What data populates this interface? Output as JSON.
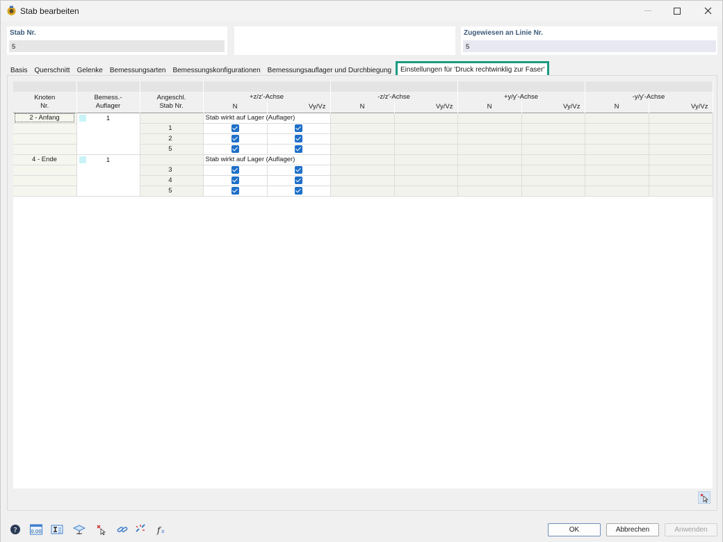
{
  "window": {
    "title": "Stab bearbeiten",
    "icon": "rstab-app-icon"
  },
  "header": {
    "stab_label": "Stab Nr.",
    "stab_value": "5",
    "zugewiesen_label": "Zugewiesen an Linie Nr.",
    "zugewiesen_value": "5"
  },
  "tabs": [
    {
      "label": "Basis"
    },
    {
      "label": "Querschnitt"
    },
    {
      "label": "Gelenke"
    },
    {
      "label": "Bemessungsarten"
    },
    {
      "label": "Bemessungskonfigurationen"
    },
    {
      "label": "Bemessungsauflager und Durchbiegung"
    },
    {
      "label": "Einstellungen für 'Druck rechtwinklig zur Faser'",
      "active": true
    }
  ],
  "table": {
    "col_knoten": "Knoten\nNr.",
    "col_knoten_l1": "Knoten",
    "col_knoten_l2": "Nr.",
    "col_bemess_l1": "Bemess.-",
    "col_bemess_l2": "Auflager",
    "col_angeschl_l1": "Angeschl.",
    "col_angeschl_l2": "Stab Nr.",
    "groups": [
      "+z/z'-Achse",
      "-z/z'-Achse",
      "+y/y'-Achse",
      "-y/y'-Achse"
    ],
    "sub_n": "N",
    "sub_v": "Vy/Vz",
    "rows": [
      {
        "knoten": "2 - Anfang",
        "auflager": "1",
        "info": "Stab wirkt auf Lager (Auflager)",
        "members": [
          "1",
          "2",
          "5"
        ]
      },
      {
        "knoten": "4 - Ende",
        "auflager": "1",
        "info": "Stab wirkt auf Lager (Auflager)",
        "members": [
          "3",
          "4",
          "5"
        ]
      }
    ]
  },
  "footer": {
    "ok_label": "OK",
    "cancel_label": "Abbrechen",
    "apply_label": "Anwenden",
    "tool_icons": [
      "help-icon",
      "units-icon",
      "section-icon",
      "view-icon",
      "delete-selection-icon",
      "link-icon",
      "unlink-icon",
      "function-icon"
    ]
  },
  "colors": {
    "active_tab_border": "#1a9a80",
    "checkbox": "#1e6fc8",
    "support_swatch": "#c9f3f7",
    "header_label": "#3d5a7a"
  }
}
